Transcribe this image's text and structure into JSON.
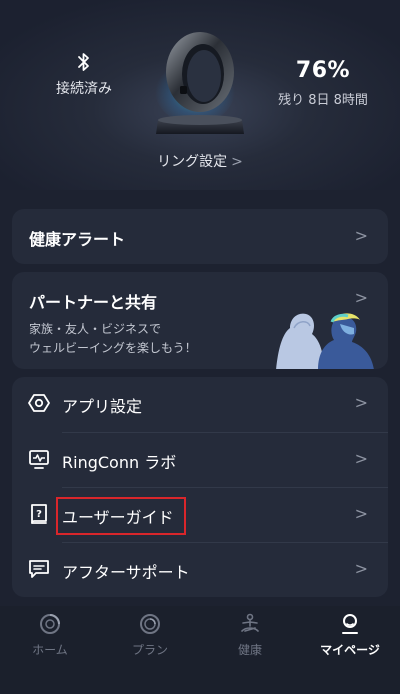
{
  "header": {
    "connection_status": "接続済み",
    "battery_percent": "76%",
    "battery_remaining": "残り 8日 8時間",
    "ring_settings_label": "リング設定",
    "chevron": ">"
  },
  "alert_card": {
    "title": "健康アラート",
    "chevron": ">"
  },
  "partner_card": {
    "title": "パートナーと共有",
    "description_line1": "家族・友人・ビジネスで",
    "description_line2": "ウェルビーイングを楽しもう！",
    "chevron": ">"
  },
  "menu": {
    "items": [
      {
        "label": "アプリ設定",
        "icon": "hexagon-settings-icon"
      },
      {
        "label": "RingConn ラボ",
        "icon": "monitor-pulse-icon"
      },
      {
        "label": "ユーザーガイド",
        "icon": "guide-book-icon"
      },
      {
        "label": "アフターサポート",
        "icon": "chat-support-icon"
      }
    ],
    "chevron": ">",
    "highlight_color": "#d9262b"
  },
  "tabbar": {
    "tabs": [
      {
        "label": "ホーム",
        "icon": "home-ring-icon",
        "active": false
      },
      {
        "label": "プラン",
        "icon": "plan-ring-icon",
        "active": false
      },
      {
        "label": "健康",
        "icon": "meditation-icon",
        "active": false
      },
      {
        "label": "マイページ",
        "icon": "profile-icon",
        "active": true
      }
    ]
  },
  "colors": {
    "background": "#1d2230",
    "card": "#252b3a",
    "accent_glow": "#3cc8a0"
  }
}
